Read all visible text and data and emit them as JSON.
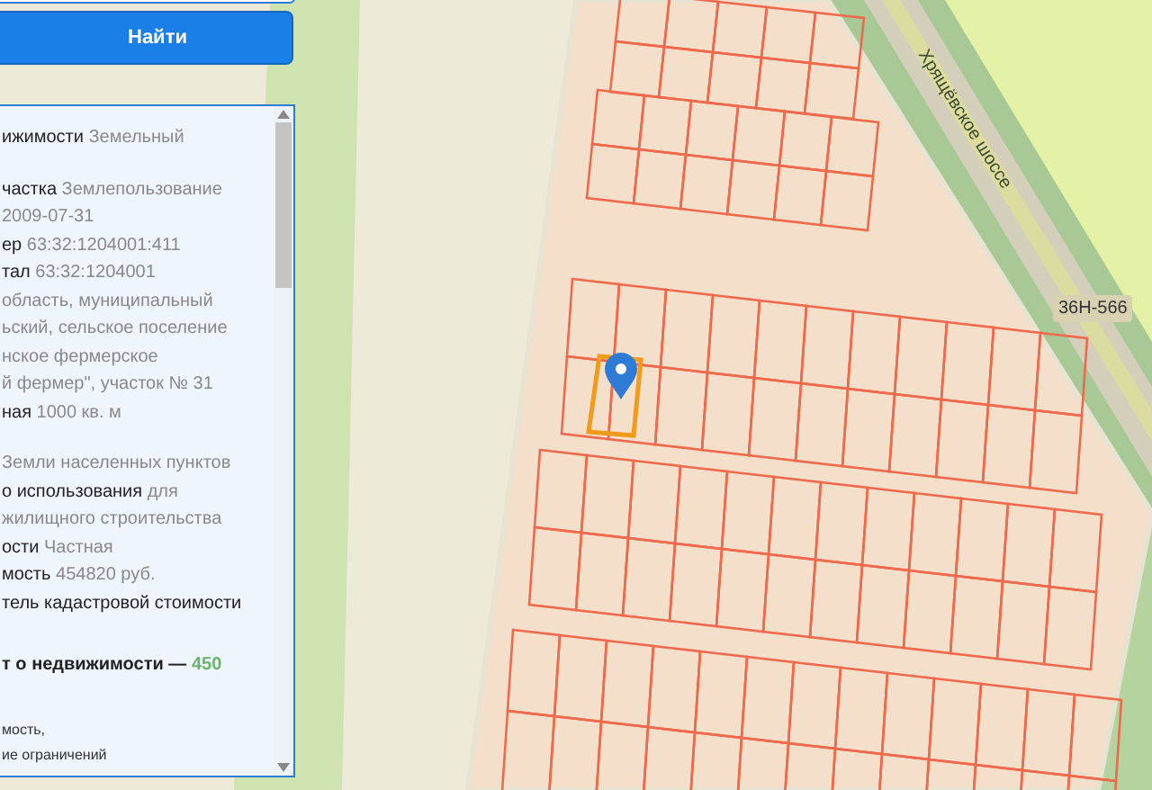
{
  "search_button": {
    "label": "Найти"
  },
  "info_lines": [
    {
      "kind": "field",
      "label": "ижимости",
      "value": "Земельный"
    },
    {
      "kind": "blank"
    },
    {
      "kind": "field",
      "label": "частка",
      "value": "Землепользование"
    },
    {
      "kind": "field",
      "value": "2009-07-31"
    },
    {
      "kind": "field",
      "label": "ер",
      "value": "63:32:1204001:411"
    },
    {
      "kind": "field",
      "label": "тал",
      "value": "63:32:1204001"
    },
    {
      "kind": "field",
      "value": "область, муниципальный"
    },
    {
      "kind": "field",
      "value": "ьский, сельское поселение"
    },
    {
      "kind": "field",
      "value": "нское фермерское"
    },
    {
      "kind": "field",
      "value": "й фермер\", участок № 31"
    },
    {
      "kind": "field",
      "label": "ная",
      "value": "1000 кв. м"
    },
    {
      "kind": "blank"
    },
    {
      "kind": "field",
      "value": "Земли населенных пунктов"
    },
    {
      "kind": "field",
      "label": "о использования",
      "value": "для"
    },
    {
      "kind": "field",
      "value": "жилищного строительства"
    },
    {
      "kind": "field",
      "label": "ости",
      "value": "Частная"
    },
    {
      "kind": "field",
      "label": "мость",
      "value": "454820 руб."
    },
    {
      "kind": "field",
      "label": "тель кадастровой стоимости"
    },
    {
      "kind": "blank"
    },
    {
      "kind": "price",
      "label": "т о недвижимости —",
      "value": "450"
    },
    {
      "kind": "blank"
    },
    {
      "kind": "note",
      "value": "мость,"
    },
    {
      "kind": "note",
      "value": "ие ограничений"
    }
  ],
  "map": {
    "road_name": "Хрящёвское шоссе",
    "road_number": "36Н-566"
  }
}
